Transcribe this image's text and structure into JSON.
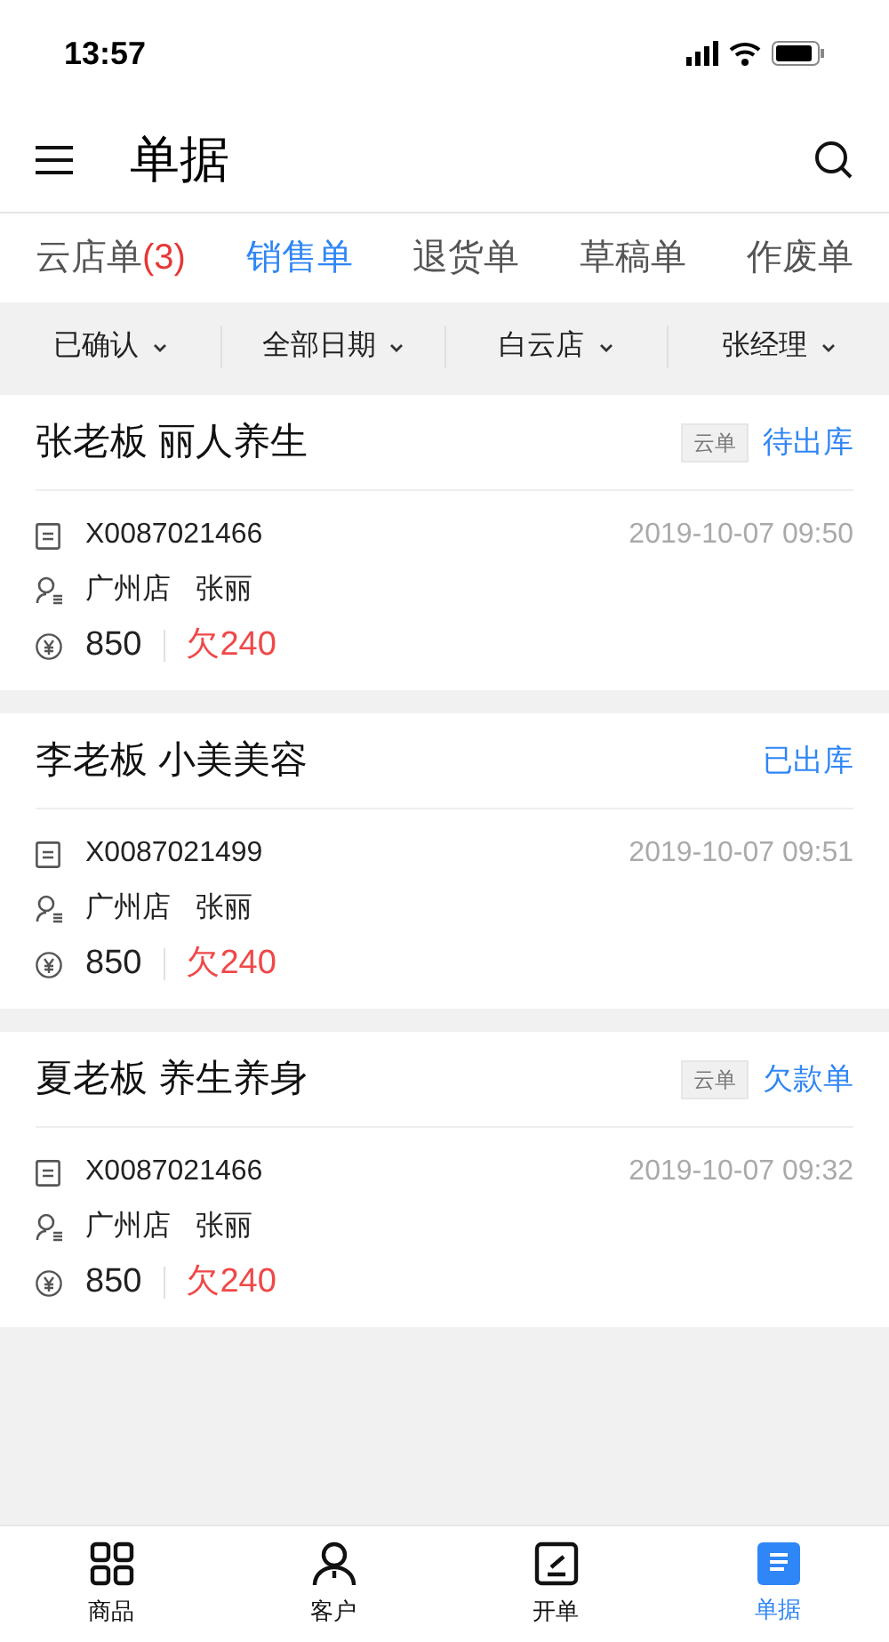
{
  "status_bar": {
    "time": "13:57"
  },
  "header": {
    "title": "单据"
  },
  "tabs": [
    {
      "label": "云店单",
      "count": "(3)",
      "selected": false
    },
    {
      "label": "销售单",
      "selected": true
    },
    {
      "label": "退货单",
      "selected": false
    },
    {
      "label": "草稿单",
      "selected": false
    },
    {
      "label": "作废单",
      "selected": false
    }
  ],
  "filters": [
    "已确认",
    "全部日期",
    "白云店",
    "张经理"
  ],
  "orders": [
    {
      "customer": "张老板 丽人养生",
      "tag": "云单",
      "status": "待出库",
      "number": "X0087021466",
      "time": "2019-10-07 09:50",
      "store": "广州店",
      "staff": "张丽",
      "amount": "850",
      "owed": "欠240"
    },
    {
      "customer": "李老板 小美美容",
      "status": "已出库",
      "number": "X0087021499",
      "time": "2019-10-07 09:51",
      "store": "广州店",
      "staff": "张丽",
      "amount": "850",
      "owed": "欠240"
    },
    {
      "customer": "夏老板 养生养身",
      "tag": "云单",
      "status": "欠款单",
      "number": "X0087021466",
      "time": "2019-10-07 09:32",
      "store": "广州店",
      "staff": "张丽",
      "amount": "850",
      "owed": "欠240"
    }
  ],
  "bottom_nav": [
    {
      "label": "商品",
      "selected": false
    },
    {
      "label": "客户",
      "selected": false
    },
    {
      "label": "开单",
      "selected": false
    },
    {
      "label": "单据",
      "selected": true
    }
  ]
}
